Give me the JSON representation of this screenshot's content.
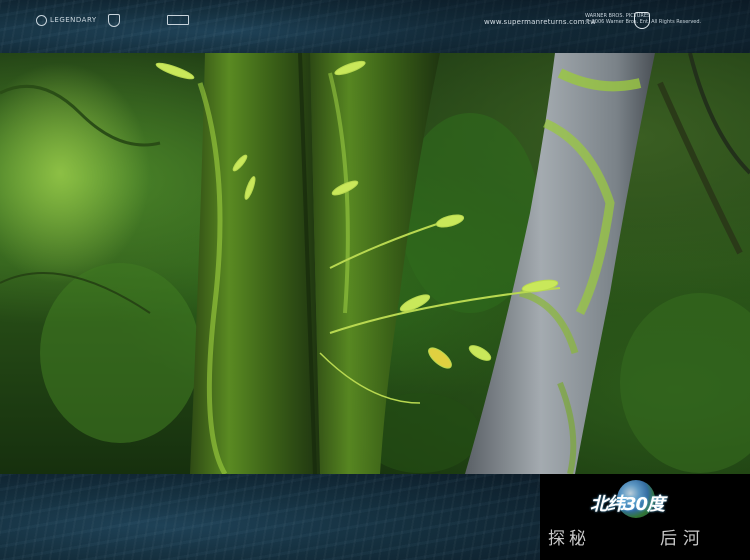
{
  "top_banner": {
    "logos": [
      "LEGENDARY",
      "",
      ""
    ],
    "url": "www.supermanreturns.com.tw",
    "studio_line1": "WARNER BROS. PICTURES",
    "studio_line2": "© 2006 Warner Bros. Ent. All Rights Reserved."
  },
  "bottom_logo": {
    "title": "北纬30度",
    "left_text": "探秘",
    "right_text": "后河"
  },
  "colors": {
    "ocean": "#15303f",
    "moss": "#8fc43a",
    "bark": "#8a9096",
    "leaf": "#c9e85a"
  }
}
